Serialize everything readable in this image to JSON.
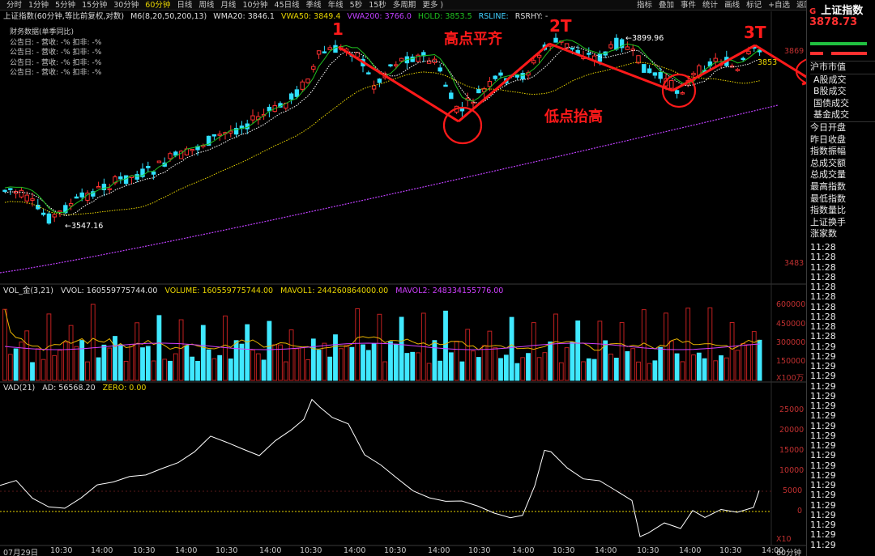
{
  "toolbar": {
    "periods": [
      "分时",
      "1分钟",
      "5分钟",
      "15分钟",
      "30分钟",
      "60分钟",
      "日线",
      "周线",
      "月线",
      "10分钟",
      "45日线",
      "季线",
      "年线",
      "5秒",
      "15秒",
      "多周期",
      "更多 )"
    ],
    "active_period": "60分钟",
    "tools": [
      "指标",
      "叠加",
      "事件",
      "统计",
      "画线",
      "标记",
      "+自选",
      "返回"
    ]
  },
  "indicator_line": {
    "name": "上证指数(60分钟,等比前复权,对数)",
    "m6": "M6(8,20,50,200,13)",
    "wma20": "WMA20: 3846.1",
    "vwa50": "VWA50: 3849.4",
    "vwa200": "VWA200: 3766.0",
    "hold": "HOLD: 3853.5",
    "rsline": "RSLINE:",
    "rsrhy": "RSRHY: -"
  },
  "finance": {
    "title": "财务数据(单季同比)",
    "rows": [
      "公告日: -   营收: -%   扣非: -%",
      "公告日: -   营收: -%   扣非: -%",
      "公告日: -   营收: -%   扣非: -%",
      "公告日: -   营收: -%   扣非: -%",
      "公告日: -   营收: -%   扣非: -%"
    ]
  },
  "price_chart": {
    "labels": {
      "low": "3547.16",
      "high": "3899.96",
      "right_top": "3869",
      "right_mid": "3853",
      "right_bottom": "3483"
    }
  },
  "annotations": {
    "a1": "1",
    "a2t": "2T",
    "a3t": "3T",
    "high_flat": "高点平齐",
    "low_rising": "低点抬高"
  },
  "volume_panel": {
    "title": "VOL_金(3,21)",
    "vvol": "VVOL: 160559775744.00",
    "volume": "VOLUME: 160559775744.00",
    "mavol1": "MAVOL1: 244260864000.00",
    "mavol2": "MAVOL2: 248334155776.00",
    "axis": [
      "600000",
      "450000",
      "300000",
      "150000"
    ],
    "unit": "X100万"
  },
  "vad_panel": {
    "title": "VAD(21)",
    "ad": "AD: 56568.20",
    "zero": "ZERO: 0.00",
    "axis": [
      "25000",
      "20000",
      "15000",
      "10000",
      "5000",
      "0"
    ],
    "unit": "X10"
  },
  "x_axis": {
    "labels": [
      "07月29日",
      "10:30",
      "14:00",
      "10:30",
      "14:00",
      "10:30",
      "14:00",
      "10:30",
      "14:00",
      "10:30",
      "14:00",
      "10:30",
      "14:00",
      "10:30",
      "14:00",
      "10:30",
      "14:00",
      "10:30",
      "14:00",
      "10:30"
    ],
    "period": "60分钟"
  },
  "right_panel": {
    "g": "G",
    "title": "上证指数",
    "price": "3878.73",
    "menu_header": "沪市市值",
    "menu": [
      "A股成交",
      "B股成交",
      "国债成交",
      "基金成交"
    ],
    "menu2": [
      "今日开盘",
      "昨日收盘",
      "指数振幅",
      "总成交额",
      "总成交量",
      "最高指数",
      "最低指数",
      "指数量比",
      "上证换手",
      "涨家数"
    ],
    "times": [
      "11:28",
      "11:28",
      "11:28",
      "11:28",
      "11:28",
      "11:28",
      "11:28",
      "11:28",
      "11:28",
      "11:28",
      "11:29",
      "11:29",
      "11:29",
      "11:29",
      "11:29",
      "11:29",
      "11:29",
      "11:29",
      "11:29",
      "11:29",
      "11:29",
      "11:29",
      "11:29",
      "11:29",
      "11:29",
      "11:29",
      "11:29",
      "11:29",
      "11:29",
      "11:29",
      "11:29"
    ]
  }
}
